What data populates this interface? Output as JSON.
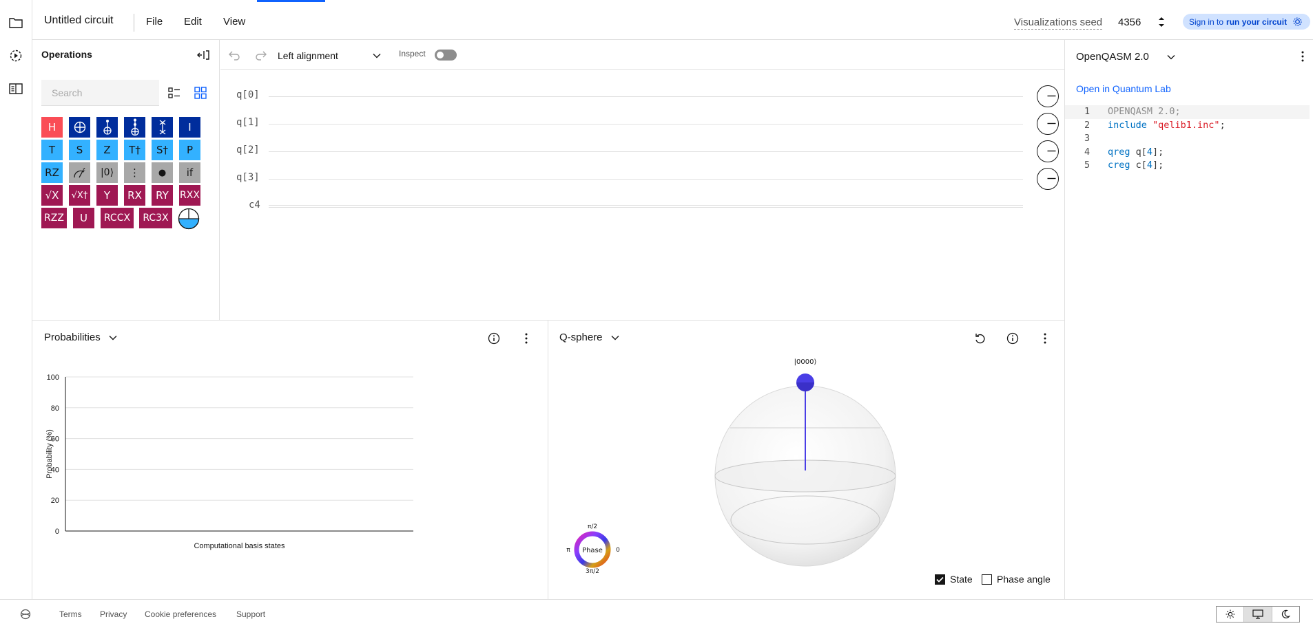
{
  "header": {
    "title": "Untitled circuit",
    "menus": [
      "File",
      "Edit",
      "View"
    ],
    "seed_label": "Visualizations seed",
    "seed_value": "4356",
    "signin_prefix": "Sign in to",
    "signin_action": "run your circuit"
  },
  "operations": {
    "title": "Operations",
    "search_placeholder": "Search",
    "gates": [
      {
        "label": "H",
        "color": "#fa4d56"
      },
      {
        "label": "CNOT",
        "color": "#002d9c"
      },
      {
        "label": "CCX",
        "color": "#002d9c"
      },
      {
        "label": "C3X",
        "color": "#002d9c"
      },
      {
        "label": "SWAP",
        "color": "#002d9c"
      },
      {
        "label": "I",
        "color": "#002d9c"
      },
      {
        "label": "T",
        "color": "#33b1ff"
      },
      {
        "label": "S",
        "color": "#33b1ff"
      },
      {
        "label": "Z",
        "color": "#33b1ff"
      },
      {
        "label": "T†",
        "color": "#33b1ff"
      },
      {
        "label": "S†",
        "color": "#33b1ff"
      },
      {
        "label": "P",
        "color": "#33b1ff"
      },
      {
        "label": "RZ",
        "color": "#33b1ff"
      },
      {
        "label": "Measure-Z",
        "color": "#a8a8a8"
      },
      {
        "label": "|0⟩",
        "color": "#a8a8a8"
      },
      {
        "label": "⋮",
        "color": "#a8a8a8"
      },
      {
        "label": "●",
        "color": "#a8a8a8"
      },
      {
        "label": "if",
        "color": "#a8a8a8"
      },
      {
        "label": "√X",
        "color": "#9f1853"
      },
      {
        "label": "√X†",
        "color": "#9f1853"
      },
      {
        "label": "Y",
        "color": "#9f1853"
      },
      {
        "label": "RX",
        "color": "#9f1853"
      },
      {
        "label": "RY",
        "color": "#9f1853"
      },
      {
        "label": "RXX",
        "color": "#9f1853"
      },
      {
        "label": "RZZ",
        "color": "#9f1853"
      },
      {
        "label": "U",
        "color": "#9f1853"
      },
      {
        "label": "RCCX",
        "color": "#9f1853"
      },
      {
        "label": "RC3X",
        "color": "#9f1853"
      }
    ]
  },
  "toolbar": {
    "alignment": "Left alignment",
    "inspect_label": "Inspect"
  },
  "circuit": {
    "qubits": [
      "q[0]",
      "q[1]",
      "q[2]",
      "q[3]"
    ],
    "classical": "c4"
  },
  "code_panel": {
    "language": "OpenQASM 2.0",
    "open_link": "Open in Quantum Lab",
    "lines": [
      {
        "n": "1",
        "parts": [
          {
            "t": "OPENQASM 2.0;",
            "c": "c-gray"
          }
        ]
      },
      {
        "n": "2",
        "parts": [
          {
            "t": "include ",
            "c": "c-teal"
          },
          {
            "t": "\"qelib1.inc\"",
            "c": "c-red"
          },
          {
            "t": ";",
            "c": "c-dark"
          }
        ]
      },
      {
        "n": "3",
        "parts": []
      },
      {
        "n": "4",
        "parts": [
          {
            "t": "qreg ",
            "c": "c-teal"
          },
          {
            "t": "q[",
            "c": "c-dark"
          },
          {
            "t": "4",
            "c": "c-teal"
          },
          {
            "t": "];",
            "c": "c-dark"
          }
        ]
      },
      {
        "n": "5",
        "parts": [
          {
            "t": "creg ",
            "c": "c-teal"
          },
          {
            "t": "c[",
            "c": "c-dark"
          },
          {
            "t": "4",
            "c": "c-teal"
          },
          {
            "t": "];",
            "c": "c-dark"
          }
        ]
      }
    ]
  },
  "probabilities": {
    "title": "Probabilities"
  },
  "chart_data": {
    "type": "bar",
    "categories": [],
    "values": [],
    "xlabel": "Computational basis states",
    "ylabel": "Probability (%)",
    "ylim": [
      0,
      100
    ],
    "yticks": [
      "0",
      "20",
      "40",
      "60",
      "80",
      "100"
    ],
    "grid": true
  },
  "qsphere": {
    "title": "Q-sphere",
    "state_label": "|0000⟩",
    "phase_label": "Phase",
    "phase_pi2": "π/2",
    "phase_pi": "π",
    "phase_0": "0",
    "phase_3pi2": "3π/2",
    "state_checkbox": "State",
    "phase_checkbox": "Phase angle",
    "state_color": "#4a3ee6"
  },
  "footer": {
    "links": [
      "Terms",
      "Privacy",
      "Cookie preferences",
      "Support"
    ]
  }
}
